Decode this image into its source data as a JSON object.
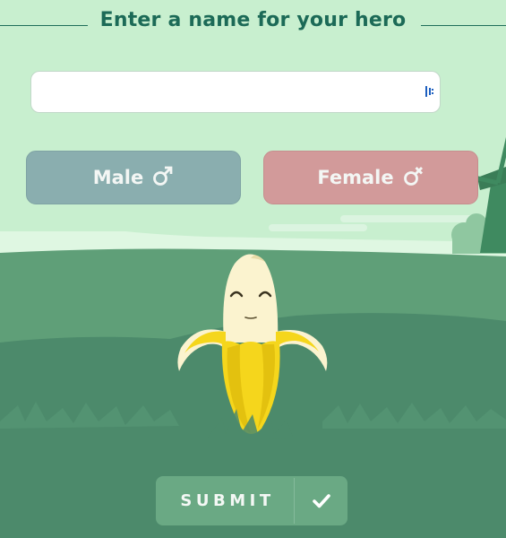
{
  "prompt": {
    "title": "Enter a name for your hero"
  },
  "name_field": {
    "value": "",
    "placeholder": ""
  },
  "gender": {
    "male_label": "Male",
    "female_label": "Female",
    "male_icon": "male-symbol-icon",
    "female_icon": "female-symbol-icon"
  },
  "submit": {
    "label": "SUBMIT",
    "icon": "checkmark-icon"
  },
  "colors": {
    "sky": "#c8efcf",
    "title": "#1c6a57",
    "male_button": "#8aaeaf",
    "female_button": "#d29a9a",
    "grass_light": "#5f9f78",
    "grass_dark": "#4c8a6b",
    "submit_button": "#6aa984",
    "banana_peel": "#f5d61c",
    "banana_flesh": "#fbf3cf"
  }
}
